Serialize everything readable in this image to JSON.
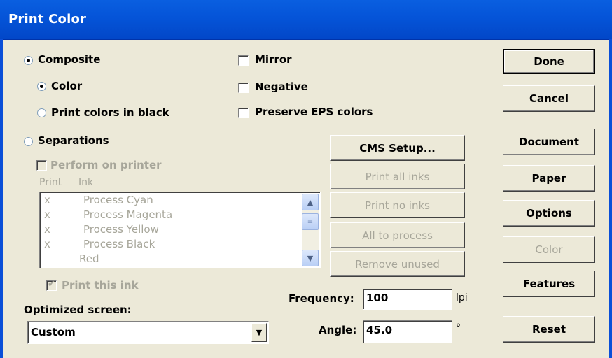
{
  "window": {
    "title": "Print Color"
  },
  "output_mode": {
    "composite_label": "Composite",
    "color_label": "Color",
    "print_colors_black_label": "Print colors in black",
    "separations_label": "Separations"
  },
  "options": {
    "mirror_label": "Mirror",
    "negative_label": "Negative",
    "preserve_eps_label": "Preserve EPS colors"
  },
  "separations": {
    "perform_on_printer_label": "Perform on printer",
    "col_print": "Print",
    "col_ink": "Ink",
    "inks": [
      {
        "print": "x",
        "name": "Process Cyan"
      },
      {
        "print": "x",
        "name": "Process Magenta"
      },
      {
        "print": "x",
        "name": "Process Yellow"
      },
      {
        "print": "x",
        "name": "Process Black"
      },
      {
        "print": "",
        "name": "Red"
      }
    ],
    "print_this_ink_label": "Print this ink"
  },
  "ink_buttons": {
    "cms_setup": "CMS Setup...",
    "print_all_inks": "Print all inks",
    "print_no_inks": "Print no inks",
    "all_to_process": "All to process",
    "remove_unused": "Remove unused"
  },
  "screen": {
    "optimized_label": "Optimized screen:",
    "optimized_value": "Custom",
    "frequency_label": "Frequency:",
    "frequency_value": "100",
    "frequency_unit": "lpi",
    "angle_label": "Angle:",
    "angle_value": "45.0",
    "angle_unit": "°"
  },
  "side_buttons": {
    "done": "Done",
    "cancel": "Cancel",
    "document": "Document",
    "paper": "Paper",
    "options": "Options",
    "color": "Color",
    "features": "Features",
    "reset": "Reset"
  }
}
